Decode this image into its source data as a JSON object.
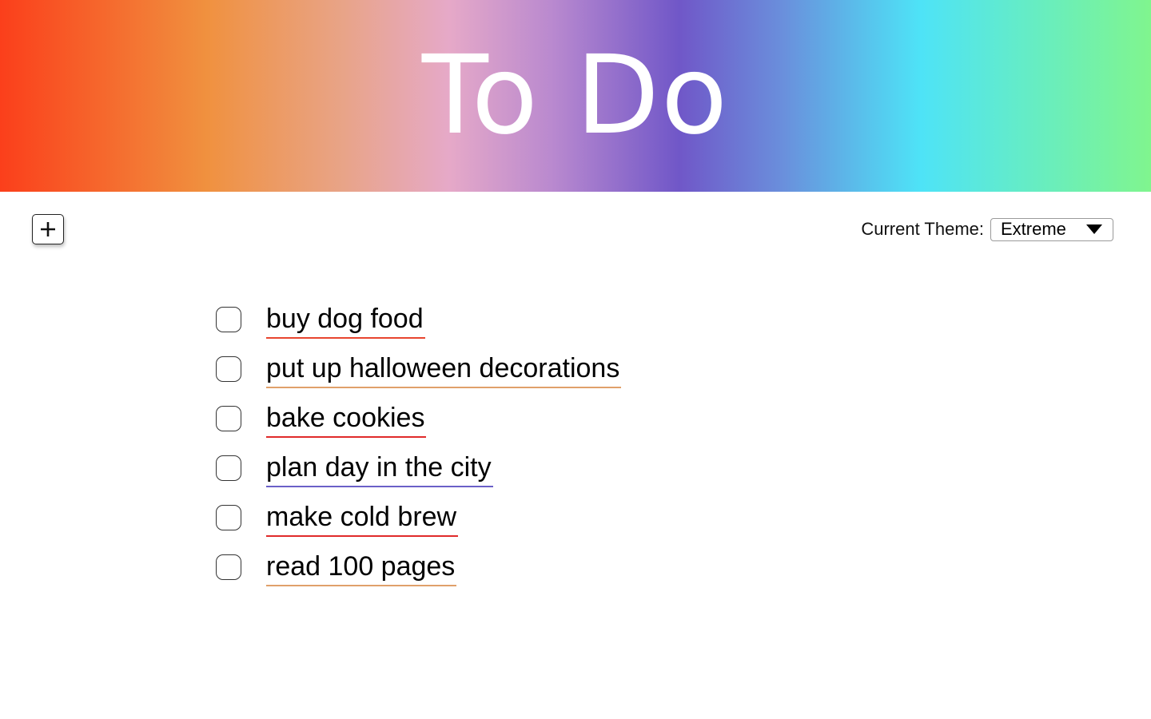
{
  "header": {
    "title": "To Do"
  },
  "toolbar": {
    "add_icon": "plus-icon",
    "theme_label": "Current Theme:",
    "theme_value": "Extreme",
    "theme_dropdown_icon": "caret-down-icon"
  },
  "todos": [
    {
      "text": "buy dog food",
      "underline_color": "#e8452f"
    },
    {
      "text": "put up halloween decorations",
      "underline_color": "#e0a06a"
    },
    {
      "text": "bake cookies",
      "underline_color": "#e02a2a"
    },
    {
      "text": "plan day in the city",
      "underline_color": "#6a60c8"
    },
    {
      "text": "make cold brew",
      "underline_color": "#e02a2a"
    },
    {
      "text": "read 100 pages",
      "underline_color": "#e0a06a"
    }
  ],
  "colors": {
    "gradient_start": "#fb3f1b",
    "gradient_mid": "#7057c8",
    "gradient_end": "#80f58e",
    "title_text": "#ffffff"
  }
}
